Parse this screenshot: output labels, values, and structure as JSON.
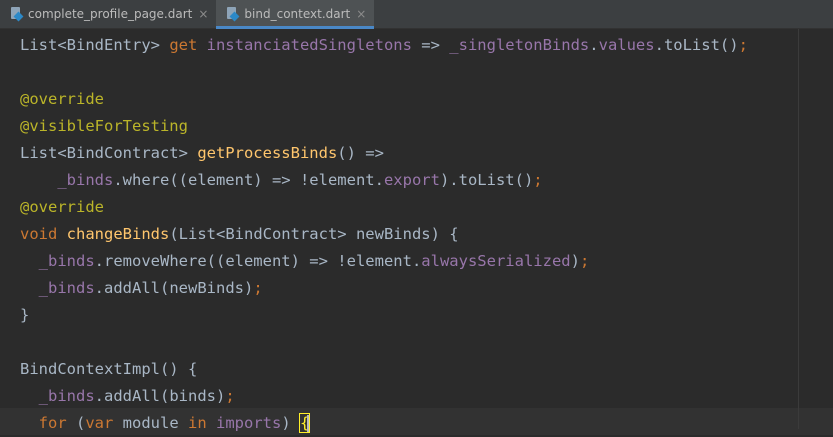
{
  "tabs": [
    {
      "label": "complete_profile_page.dart",
      "close": "×",
      "active": false
    },
    {
      "label": "bind_context.dart",
      "close": "×",
      "active": true
    }
  ],
  "code": [
    [
      [
        "t",
        "List<BindEntry> "
      ],
      [
        "k",
        "get "
      ],
      [
        "m",
        "instanciatedSingletons"
      ],
      [
        "t",
        " => "
      ],
      [
        "m",
        "_singletonBinds"
      ],
      [
        "t",
        "."
      ],
      [
        "m",
        "values"
      ],
      [
        "t",
        ".toList()"
      ],
      [
        "k",
        ";"
      ]
    ],
    [],
    [
      [
        "a",
        "@override"
      ]
    ],
    [
      [
        "a",
        "@visibleForTesting"
      ]
    ],
    [
      [
        "t",
        "List<BindContract> "
      ],
      [
        "f",
        "getProcessBinds"
      ],
      [
        "t",
        "() =>"
      ]
    ],
    [
      [
        "t",
        "    "
      ],
      [
        "m",
        "_binds"
      ],
      [
        "t",
        ".where((element) => !element."
      ],
      [
        "m",
        "export"
      ],
      [
        "t",
        ").toList()"
      ],
      [
        "k",
        ";"
      ]
    ],
    [
      [
        "a",
        "@override"
      ]
    ],
    [
      [
        "k",
        "void "
      ],
      [
        "f",
        "changeBinds"
      ],
      [
        "t",
        "(List<BindContract> newBinds) {"
      ]
    ],
    [
      [
        "t",
        "  "
      ],
      [
        "m",
        "_binds"
      ],
      [
        "t",
        ".removeWhere((element) => !element."
      ],
      [
        "m",
        "alwaysSerialized"
      ],
      [
        "t",
        ")"
      ],
      [
        "k",
        ";"
      ]
    ],
    [
      [
        "t",
        "  "
      ],
      [
        "m",
        "_binds"
      ],
      [
        "t",
        ".addAll(newBinds)"
      ],
      [
        "k",
        ";"
      ]
    ],
    [
      [
        "t",
        "}"
      ]
    ],
    [],
    [
      [
        "t",
        "BindContextImpl() {"
      ]
    ],
    [
      [
        "t",
        "  "
      ],
      [
        "m",
        "_binds"
      ],
      [
        "t",
        ".addAll(binds)"
      ],
      [
        "k",
        ";"
      ]
    ],
    [
      [
        "t",
        "  "
      ],
      [
        "k",
        "for "
      ],
      [
        "t",
        "("
      ],
      [
        "k",
        "var "
      ],
      [
        "t",
        "module "
      ],
      [
        "k",
        "in "
      ],
      [
        "m",
        "imports"
      ],
      [
        "t",
        ") "
      ],
      [
        "brace",
        "{"
      ]
    ]
  ]
}
